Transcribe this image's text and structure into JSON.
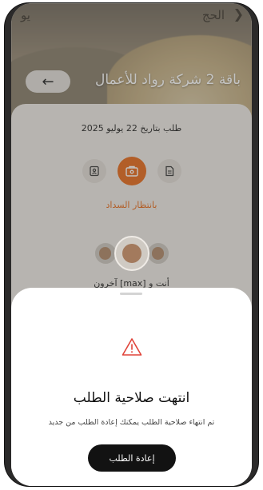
{
  "topbar": {
    "left_title": "ﯾﻮ",
    "right_title": "الحج",
    "chevron": "❯"
  },
  "hero": {
    "back_arrow": "←",
    "title": "باقة 2 شركة رواد للأعمال"
  },
  "request": {
    "date_line": "طلب بتاريخ 22 يوليو 2025",
    "status_icons": [
      "document-icon",
      "payment-icon",
      "id-card-icon"
    ],
    "status_text": "بانتظار السداد",
    "participants_text": "أنت و [max] آخرون"
  },
  "sheet": {
    "title": "انتهت صلاحية الطلب",
    "message": "تم انتهاء صلاحية الطلب يمكنك إعادة الطلب من جديد",
    "button_label": "إعادة الطلب"
  },
  "colors": {
    "accent": "#e8742a",
    "button": "#121212",
    "warning": "#e0443a"
  }
}
